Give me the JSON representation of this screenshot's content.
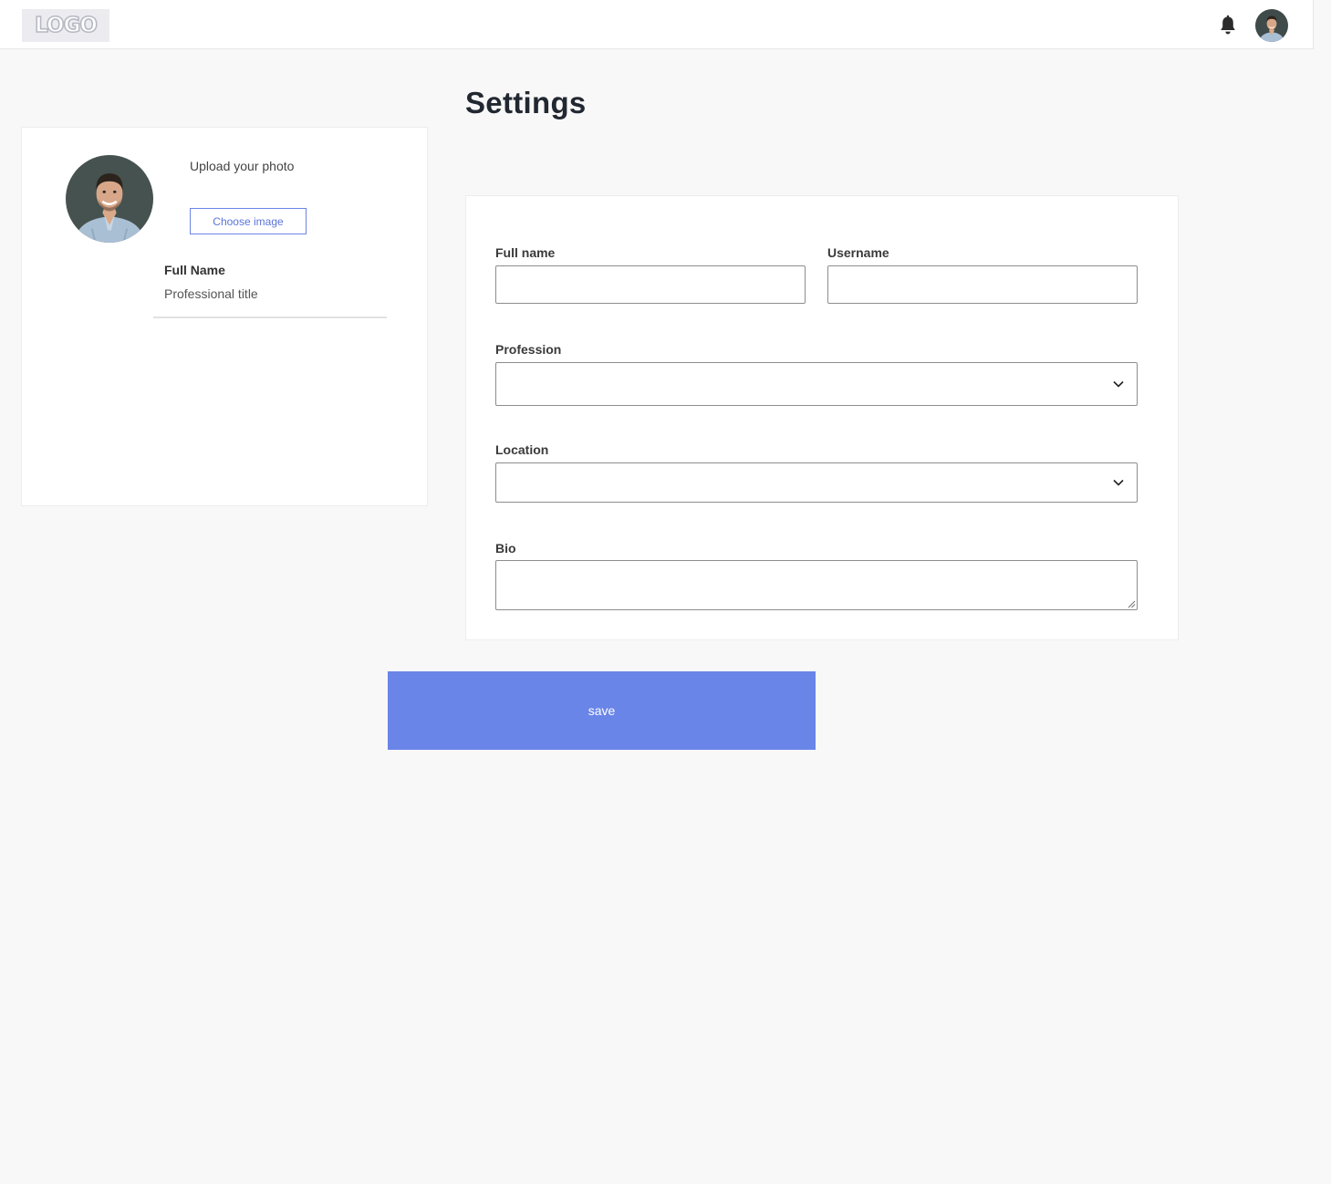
{
  "header": {
    "logo_text": "LOGO",
    "notification_icon": "bell-icon",
    "avatar": "user-avatar"
  },
  "page": {
    "title": "Settings"
  },
  "profile_card": {
    "upload_label": "Upload your photo",
    "choose_button_label": "Choose image",
    "full_name": "Full Name",
    "professional_title": "Professional title"
  },
  "form": {
    "full_name": {
      "label": "Full name",
      "value": ""
    },
    "username": {
      "label": "Username",
      "value": ""
    },
    "profession": {
      "label": "Profession",
      "selected": ""
    },
    "location": {
      "label": "Location",
      "selected": ""
    },
    "bio": {
      "label": "Bio",
      "value": ""
    }
  },
  "actions": {
    "save_label": "save"
  },
  "colors": {
    "accent": "#6a85e8",
    "background": "#f8f8f8",
    "card": "#ffffff"
  }
}
